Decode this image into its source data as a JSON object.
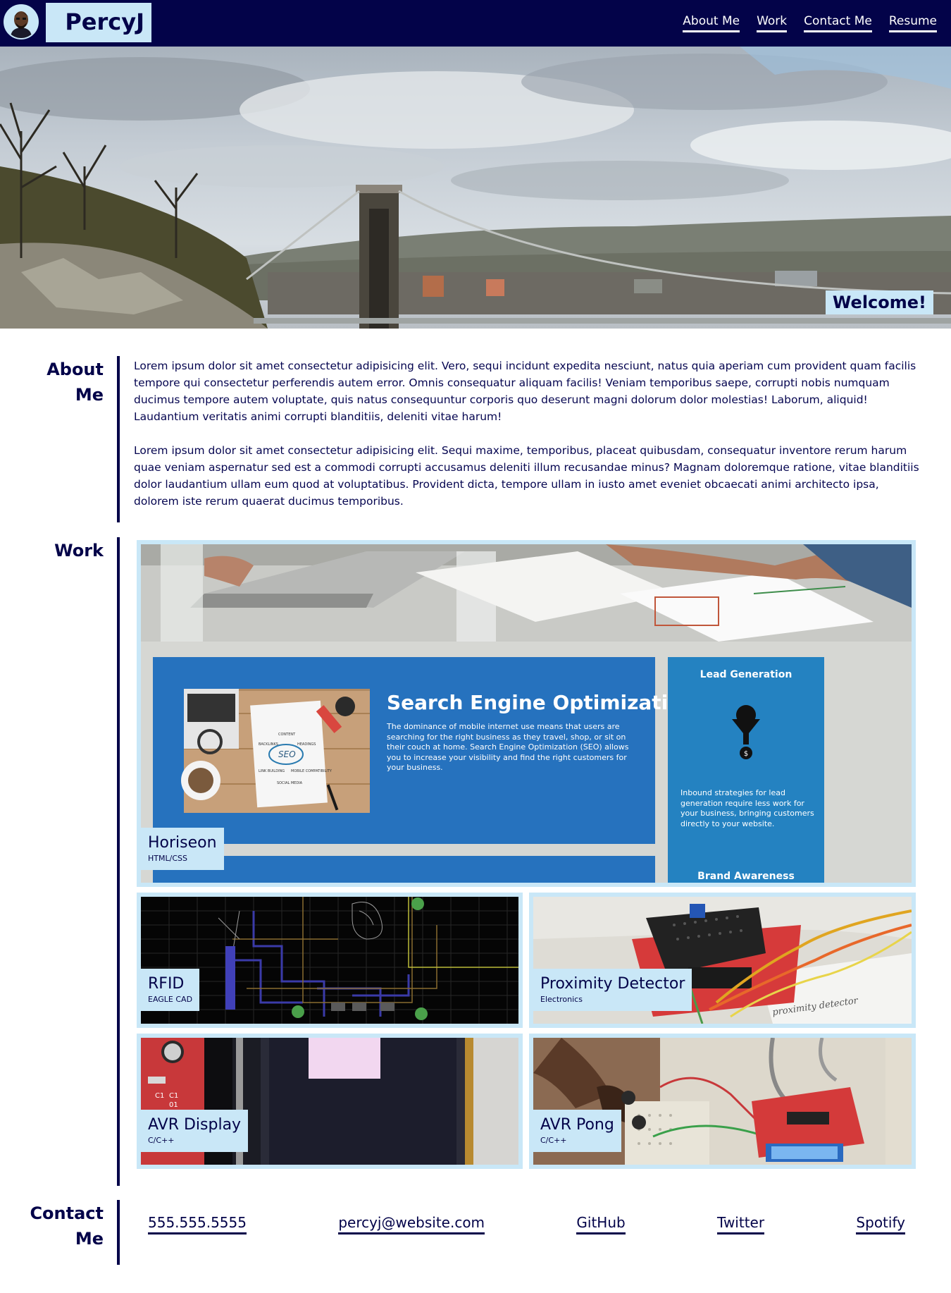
{
  "header": {
    "brand": "PercyJ",
    "nav": [
      "About Me",
      "Work",
      "Contact Me",
      "Resume"
    ]
  },
  "hero": {
    "welcome": "Welcome!"
  },
  "about": {
    "title_line1": "About",
    "title_line2": "Me",
    "paragraphs": [
      "Lorem ipsum dolor sit amet consectetur adipisicing elit. Vero, sequi incidunt expedita nesciunt, natus quia aperiam cum provident quam facilis tempore qui consectetur perferendis autem error. Omnis consequatur aliquam facilis! Veniam temporibus saepe, corrupti nobis numquam ducimus tempore autem voluptate, quis natus consequuntur corporis quo deserunt magni dolorum dolor molestias! Laborum, aliquid! Laudantium veritatis animi corrupti blanditiis, deleniti vitae harum!",
      "Lorem ipsum dolor sit amet consectetur adipisicing elit. Sequi maxime, temporibus, placeat quibusdam, consequatur inventore rerum harum quae veniam aspernatur sed est a commodi corrupti accusamus deleniti illum recusandae minus? Magnam doloremque ratione, vitae blanditiis dolor laudantium ullam eum quod at voluptatibus. Provident dicta, tempore ullam in iusto amet eveniet obcaecati animi architecto ipsa, dolorem iste rerum quaerat ducimus temporibus."
    ]
  },
  "work": {
    "title": "Work",
    "featured": {
      "name": "Horiseon",
      "tech": "HTML/CSS",
      "screenshot": {
        "seo_title": "Search Engine Optimization",
        "seo_body": "The dominance of mobile internet use means that users are searching for the right business as they travel, shop, or sit on their couch at home. Search Engine Optimization (SEO) allows you to increase your visibility and find the right customers for your business.",
        "lead_title": "Lead Generation",
        "lead_body": "Inbound strategies for lead generation require less work for your business, bringing customers directly to your website.",
        "brand_title": "Brand Awareness",
        "notebook_words": [
          "CONTENT",
          "BACKLINKS",
          "HEADINGS",
          "SEO",
          "LINK BUILDING",
          "MOBILE COMPATIBILITY",
          "SOCIAL MEDIA"
        ]
      }
    },
    "projects": [
      {
        "name": "RFID",
        "tech": "EAGLE CAD"
      },
      {
        "name": "Proximity Detector",
        "tech": "Electronics",
        "note": "proximity detector"
      },
      {
        "name": "AVR Display",
        "tech": "C/C++",
        "board_labels": [
          "C1",
          "C1",
          "01"
        ]
      },
      {
        "name": "AVR Pong",
        "tech": "C/C++"
      }
    ]
  },
  "contact": {
    "title_line1": "Contact",
    "title_line2": "Me",
    "links": [
      "555.555.5555",
      "percyj@website.com",
      "GitHub",
      "Twitter",
      "Spotify"
    ]
  },
  "colors": {
    "navy": "#030349",
    "light_blue": "#c9e7f7",
    "seo_blue": "#2672be"
  },
  "icons": [
    "avatar",
    "lead-generation-icon"
  ]
}
